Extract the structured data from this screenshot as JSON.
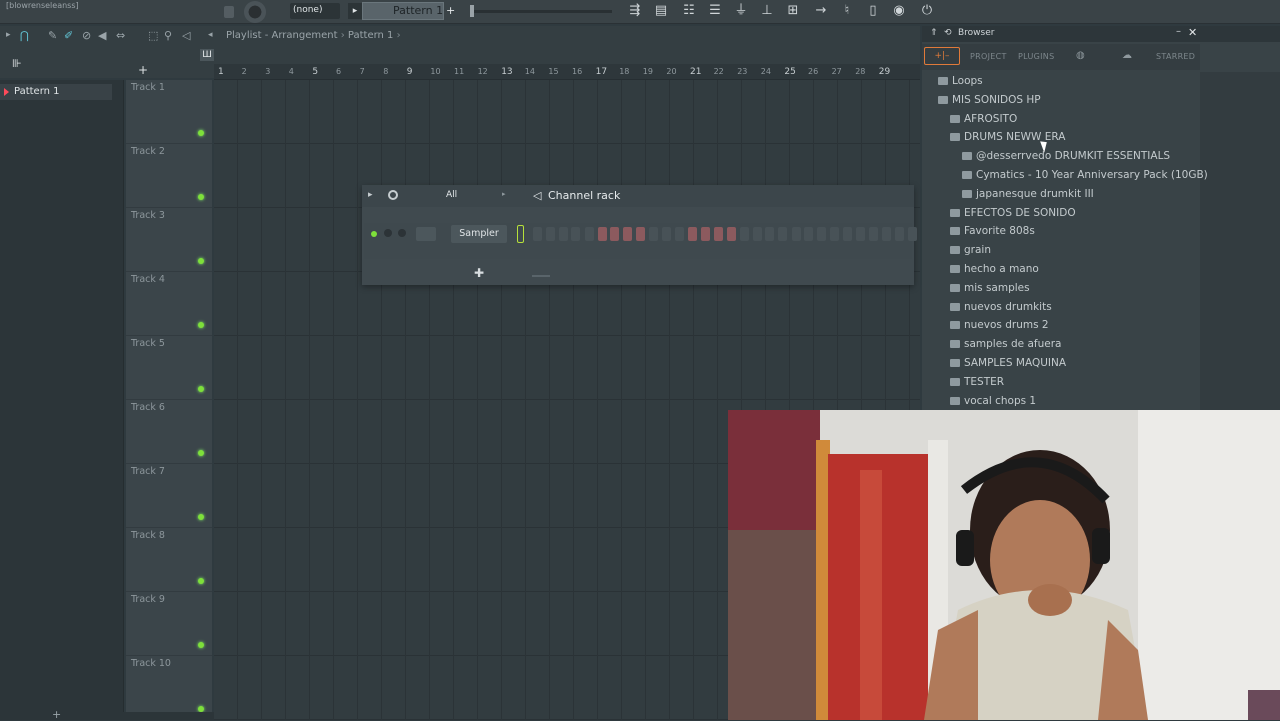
{
  "title_bar": {
    "project_name": "[blowrenseleanss]",
    "pattern_select": "(none)",
    "pattern_name": "Pattern 1"
  },
  "playlist": {
    "title": "Playlist - Arrangement",
    "pattern_crumb": "Pattern 1",
    "pattern_list": [
      "Pattern 1"
    ],
    "tracks": [
      "Track 1",
      "Track 2",
      "Track 3",
      "Track 4",
      "Track 5",
      "Track 6",
      "Track 7",
      "Track 8",
      "Track 9",
      "Track 10"
    ],
    "ruler": [
      "1",
      "2",
      "3",
      "4",
      "5",
      "6",
      "7",
      "8",
      "9",
      "10",
      "11",
      "12",
      "13",
      "14",
      "15",
      "16",
      "17",
      "18",
      "19",
      "20",
      "21",
      "22",
      "23",
      "24",
      "25",
      "26",
      "27",
      "28",
      "29"
    ]
  },
  "channel_rack": {
    "filter": "All",
    "title": "Channel rack",
    "channel": "Sampler",
    "steps": [
      "dim",
      "dim",
      "dim",
      "dim",
      "dim",
      "red",
      "red",
      "red",
      "red",
      "dim",
      "dim",
      "dim",
      "red",
      "red",
      "red",
      "red",
      "dim",
      "dim",
      "dim",
      "dim",
      "dim",
      "dim",
      "dim",
      "dim",
      "dim",
      "dim",
      "dim",
      "dim",
      "dim",
      "dim"
    ]
  },
  "browser": {
    "title": "Browser",
    "tabs": {
      "project": "PROJECT",
      "plugins": "PLUGINS",
      "starred": "STARRED"
    },
    "items": [
      {
        "label": "Loops",
        "level": 0
      },
      {
        "label": "MIS SONIDOS HP",
        "level": 0
      },
      {
        "label": "AFROSITO",
        "level": 1
      },
      {
        "label": "DRUMS NEWW ERA",
        "level": 1
      },
      {
        "label": "@desserrvedo DRUMKIT ESSENTIALS",
        "level": 2
      },
      {
        "label": "Cymatics - 10 Year Anniversary Pack (10GB)",
        "level": 2
      },
      {
        "label": "japanesque drumkit III",
        "level": 2
      },
      {
        "label": "EFECTOS DE SONIDO",
        "level": 1
      },
      {
        "label": "Favorite 808s",
        "level": 1
      },
      {
        "label": "grain",
        "level": 1
      },
      {
        "label": "hecho a mano",
        "level": 1
      },
      {
        "label": "mis samples",
        "level": 1
      },
      {
        "label": "nuevos drumkits",
        "level": 1
      },
      {
        "label": "nuevos drums 2",
        "level": 1
      },
      {
        "label": "samples de afuera",
        "level": 1
      },
      {
        "label": "SAMPLES MAQUINA",
        "level": 1
      },
      {
        "label": "TESTER",
        "level": 1
      },
      {
        "label": "vocal chops 1",
        "level": 1
      }
    ]
  },
  "colors": {
    "accent_green": "#7ee03a",
    "pattern_marker": "#ff4a5a",
    "step_red": "#8c5a5e"
  }
}
